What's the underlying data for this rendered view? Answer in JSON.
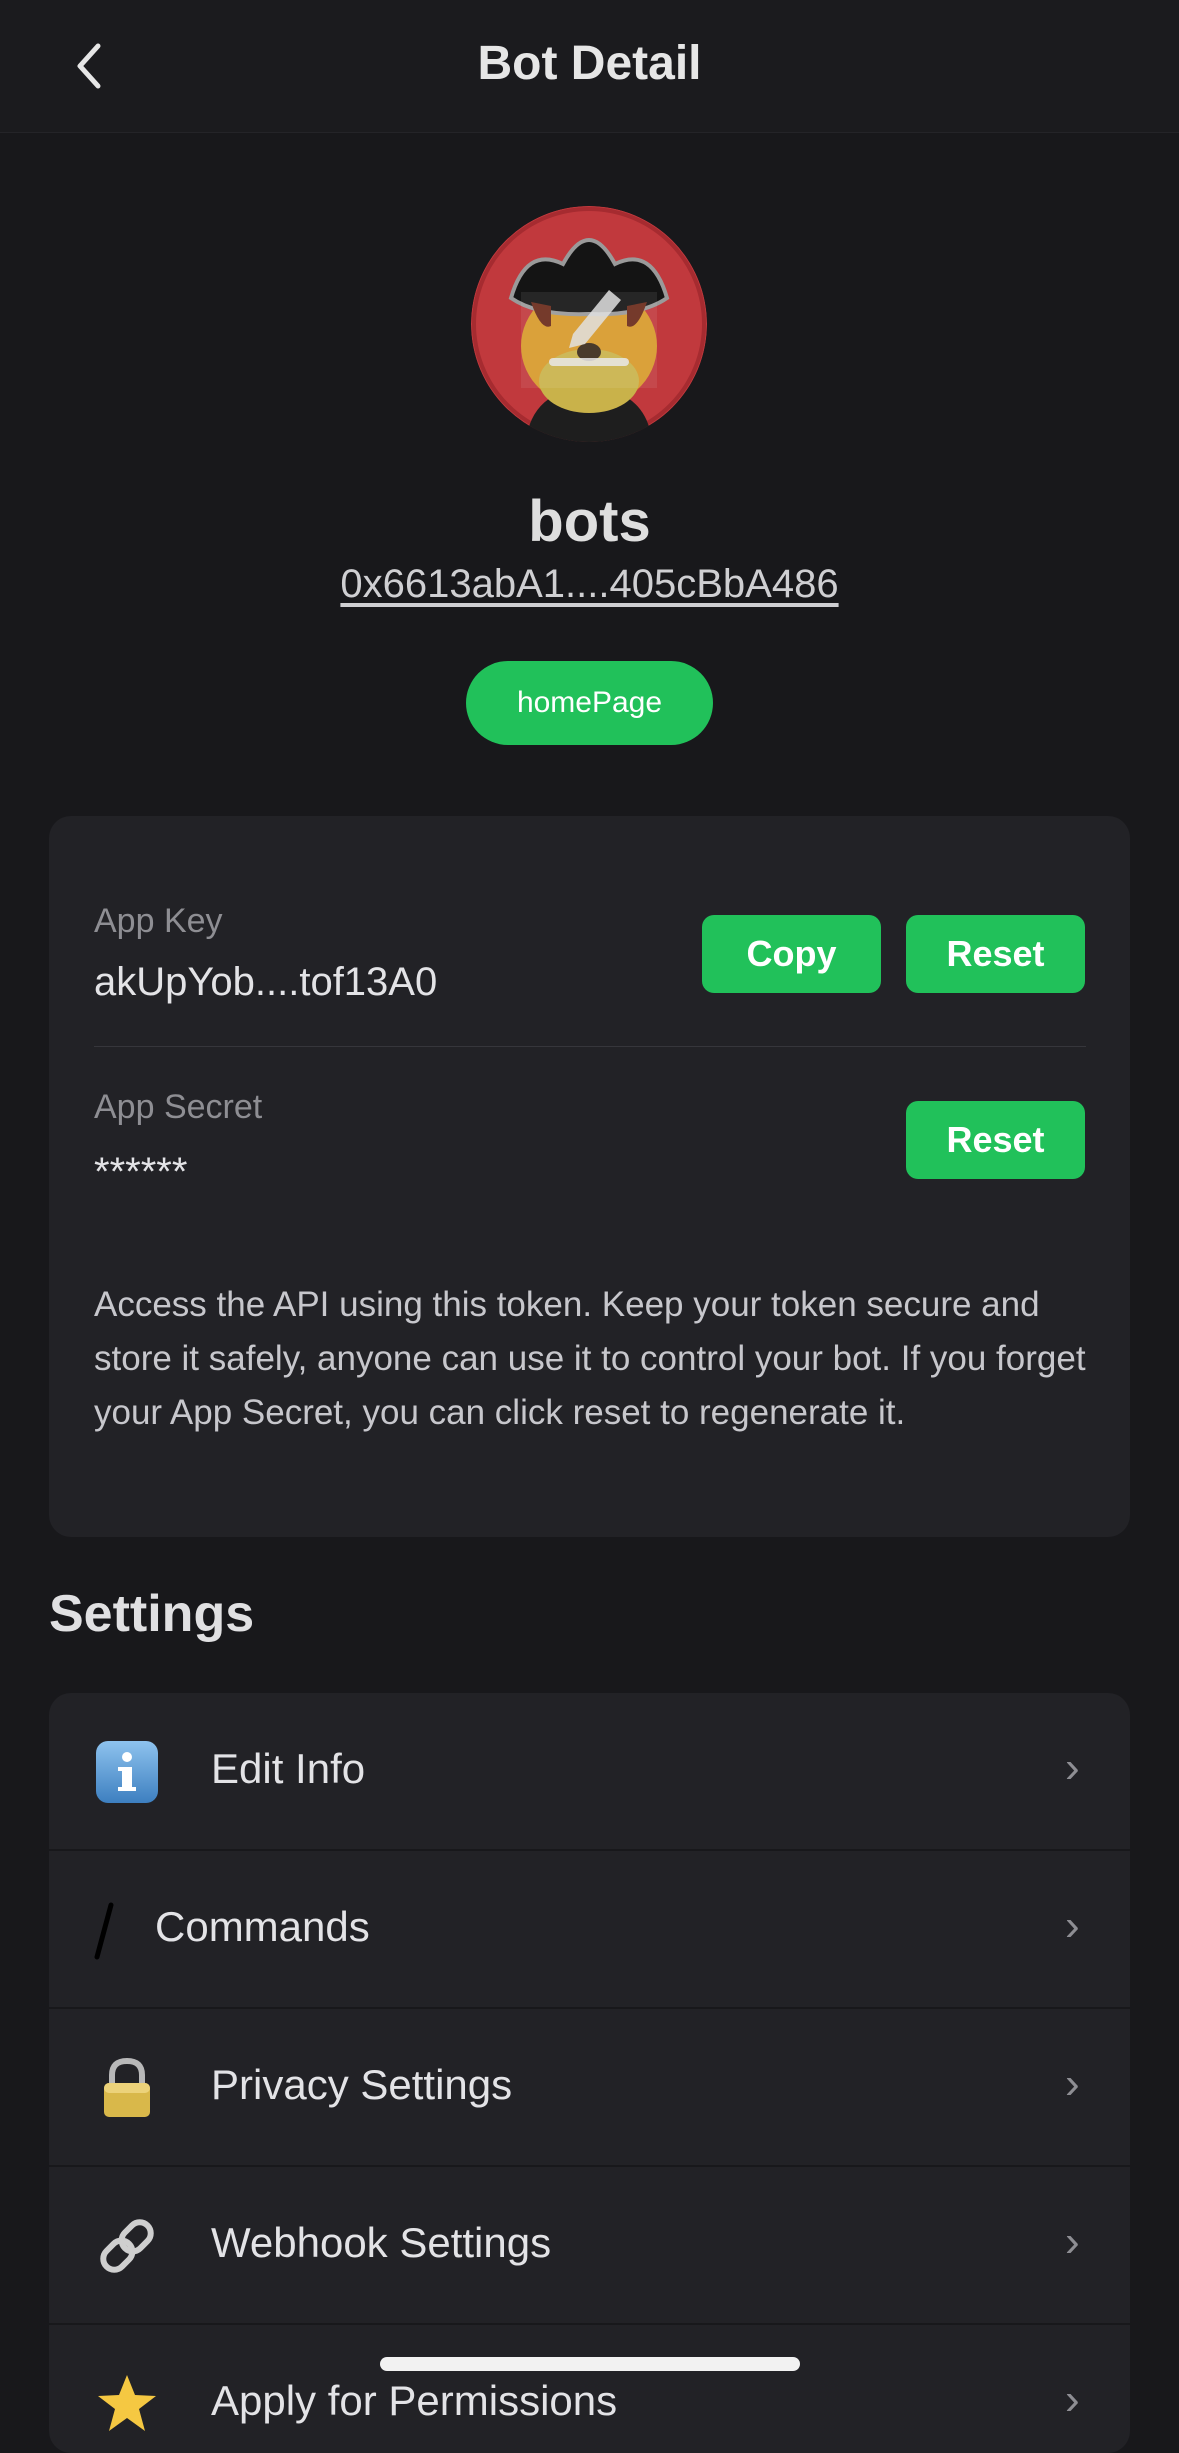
{
  "header": {
    "title": "Bot Detail"
  },
  "bot": {
    "name": "bots",
    "address": "0x6613abA1....405cBbA486",
    "homepage_label": "homePage"
  },
  "credentials": {
    "app_key_label": "App Key",
    "app_key_value": "akUpYob....tof13A0",
    "copy_label": "Copy",
    "reset_label": "Reset",
    "app_secret_label": "App Secret",
    "app_secret_value": "******",
    "secret_reset_label": "Reset",
    "description": "Access the API using this token. Keep your token secure and store it safely, anyone can use it to control your bot. If you forget your App Secret, you can click reset to regenerate it."
  },
  "settings": {
    "heading": "Settings",
    "items": [
      {
        "label": "Edit Info",
        "icon": "info-icon"
      },
      {
        "label": "Commands",
        "icon": "slash-icon"
      },
      {
        "label": "Privacy Settings",
        "icon": "lock-icon"
      },
      {
        "label": "Webhook Settings",
        "icon": "link-icon"
      },
      {
        "label": "Apply for Permissions",
        "icon": "star-icon"
      }
    ],
    "chevron": "›"
  },
  "colors": {
    "background": "#18181b",
    "card": "#222226",
    "accent_green": "#21c15a"
  }
}
